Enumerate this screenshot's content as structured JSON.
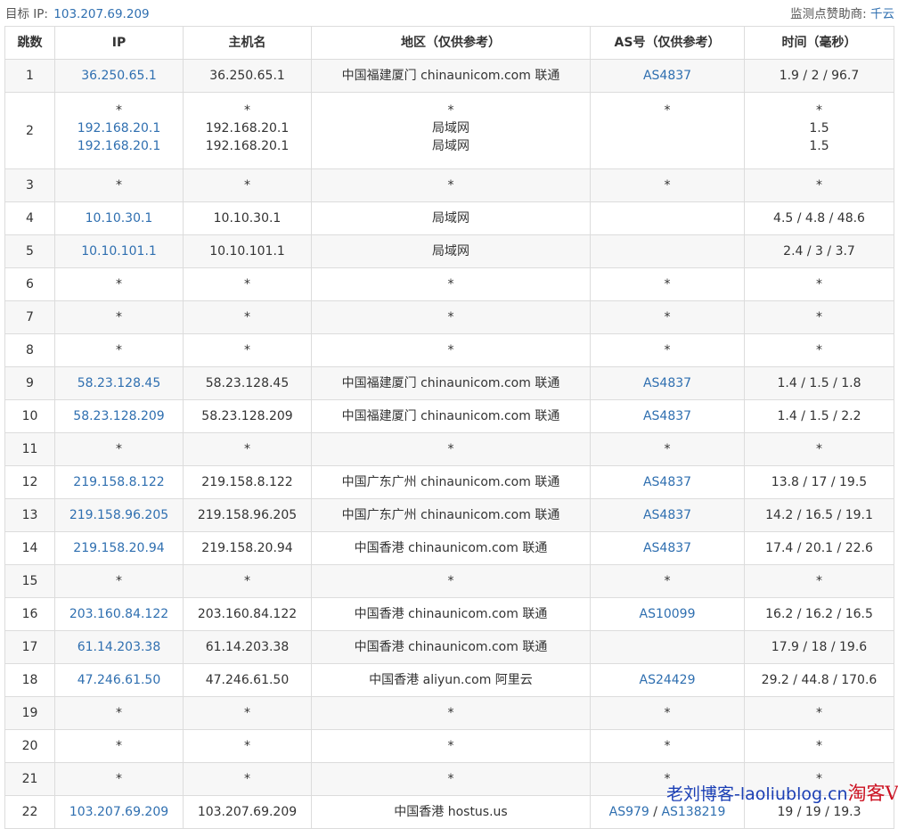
{
  "header": {
    "target_label": "目标 IP:",
    "target_ip": "103.207.69.209",
    "sponsor_label": "监测点赞助商:",
    "sponsor_name": "千云"
  },
  "columns": [
    "跳数",
    "IP",
    "主机名",
    "地区（仅供参考）",
    "AS号（仅供参考）",
    "时间（毫秒）"
  ],
  "rows": [
    {
      "hop": "1",
      "ip": "36.250.65.1",
      "host": "36.250.65.1",
      "region": "中国福建厦门 chinaunicom.com 联通",
      "as": "AS4837",
      "time": "1.9 / 2 / 96.7"
    },
    {
      "hop": "2",
      "ip_lines": [
        "*",
        "192.168.20.1",
        "192.168.20.1"
      ],
      "host_lines": [
        "*",
        "192.168.20.1",
        "192.168.20.1"
      ],
      "region_lines": [
        "*",
        "局域网",
        "局域网"
      ],
      "as": "*",
      "time_lines": [
        "*",
        "1.5",
        "1.5"
      ]
    },
    {
      "hop": "3",
      "ip": "*",
      "host": "*",
      "region": "*",
      "as": "*",
      "time": "*"
    },
    {
      "hop": "4",
      "ip": "10.10.30.1",
      "host": "10.10.30.1",
      "region": "局域网",
      "as": "",
      "time": "4.5 / 4.8 / 48.6"
    },
    {
      "hop": "5",
      "ip": "10.10.101.1",
      "host": "10.10.101.1",
      "region": "局域网",
      "as": "",
      "time": "2.4 / 3 / 3.7"
    },
    {
      "hop": "6",
      "ip": "*",
      "host": "*",
      "region": "*",
      "as": "*",
      "time": "*"
    },
    {
      "hop": "7",
      "ip": "*",
      "host": "*",
      "region": "*",
      "as": "*",
      "time": "*"
    },
    {
      "hop": "8",
      "ip": "*",
      "host": "*",
      "region": "*",
      "as": "*",
      "time": "*"
    },
    {
      "hop": "9",
      "ip": "58.23.128.45",
      "host": "58.23.128.45",
      "region": "中国福建厦门 chinaunicom.com 联通",
      "as": "AS4837",
      "time": "1.4 / 1.5 / 1.8"
    },
    {
      "hop": "10",
      "ip": "58.23.128.209",
      "host": "58.23.128.209",
      "region": "中国福建厦门 chinaunicom.com 联通",
      "as": "AS4837",
      "time": "1.4 / 1.5 / 2.2"
    },
    {
      "hop": "11",
      "ip": "*",
      "host": "*",
      "region": "*",
      "as": "*",
      "time": "*"
    },
    {
      "hop": "12",
      "ip": "219.158.8.122",
      "host": "219.158.8.122",
      "region": "中国广东广州 chinaunicom.com 联通",
      "as": "AS4837",
      "time": "13.8 / 17 / 19.5"
    },
    {
      "hop": "13",
      "ip": "219.158.96.205",
      "host": "219.158.96.205",
      "region": "中国广东广州 chinaunicom.com 联通",
      "as": "AS4837",
      "time": "14.2 / 16.5 / 19.1"
    },
    {
      "hop": "14",
      "ip": "219.158.20.94",
      "host": "219.158.20.94",
      "region": "中国香港 chinaunicom.com 联通",
      "as": "AS4837",
      "time": "17.4 / 20.1 / 22.6"
    },
    {
      "hop": "15",
      "ip": "*",
      "host": "*",
      "region": "*",
      "as": "*",
      "time": "*"
    },
    {
      "hop": "16",
      "ip": "203.160.84.122",
      "host": "203.160.84.122",
      "region": "中国香港 chinaunicom.com 联通",
      "as": "AS10099",
      "time": "16.2 / 16.2 / 16.5"
    },
    {
      "hop": "17",
      "ip": "61.14.203.38",
      "host": "61.14.203.38",
      "region": "中国香港 chinaunicom.com 联通",
      "as": "",
      "time": "17.9 / 18 / 19.6"
    },
    {
      "hop": "18",
      "ip": "47.246.61.50",
      "host": "47.246.61.50",
      "region": "中国香港 aliyun.com 阿里云",
      "as": "AS24429",
      "time": "29.2 / 44.8 / 170.6"
    },
    {
      "hop": "19",
      "ip": "*",
      "host": "*",
      "region": "*",
      "as": "*",
      "time": "*"
    },
    {
      "hop": "20",
      "ip": "*",
      "host": "*",
      "region": "*",
      "as": "*",
      "time": "*"
    },
    {
      "hop": "21",
      "ip": "*",
      "host": "*",
      "region": "*",
      "as": "*",
      "time": "*"
    },
    {
      "hop": "22",
      "ip": "103.207.69.209",
      "host": "103.207.69.209",
      "region": "中国香港 hostus.us",
      "as_list": [
        "AS979",
        "AS138219"
      ],
      "time": "19 / 19 / 19.3"
    }
  ],
  "watermark": {
    "text": "老刘博客-laoliublog.cn",
    "vps": "淘客VPS"
  }
}
